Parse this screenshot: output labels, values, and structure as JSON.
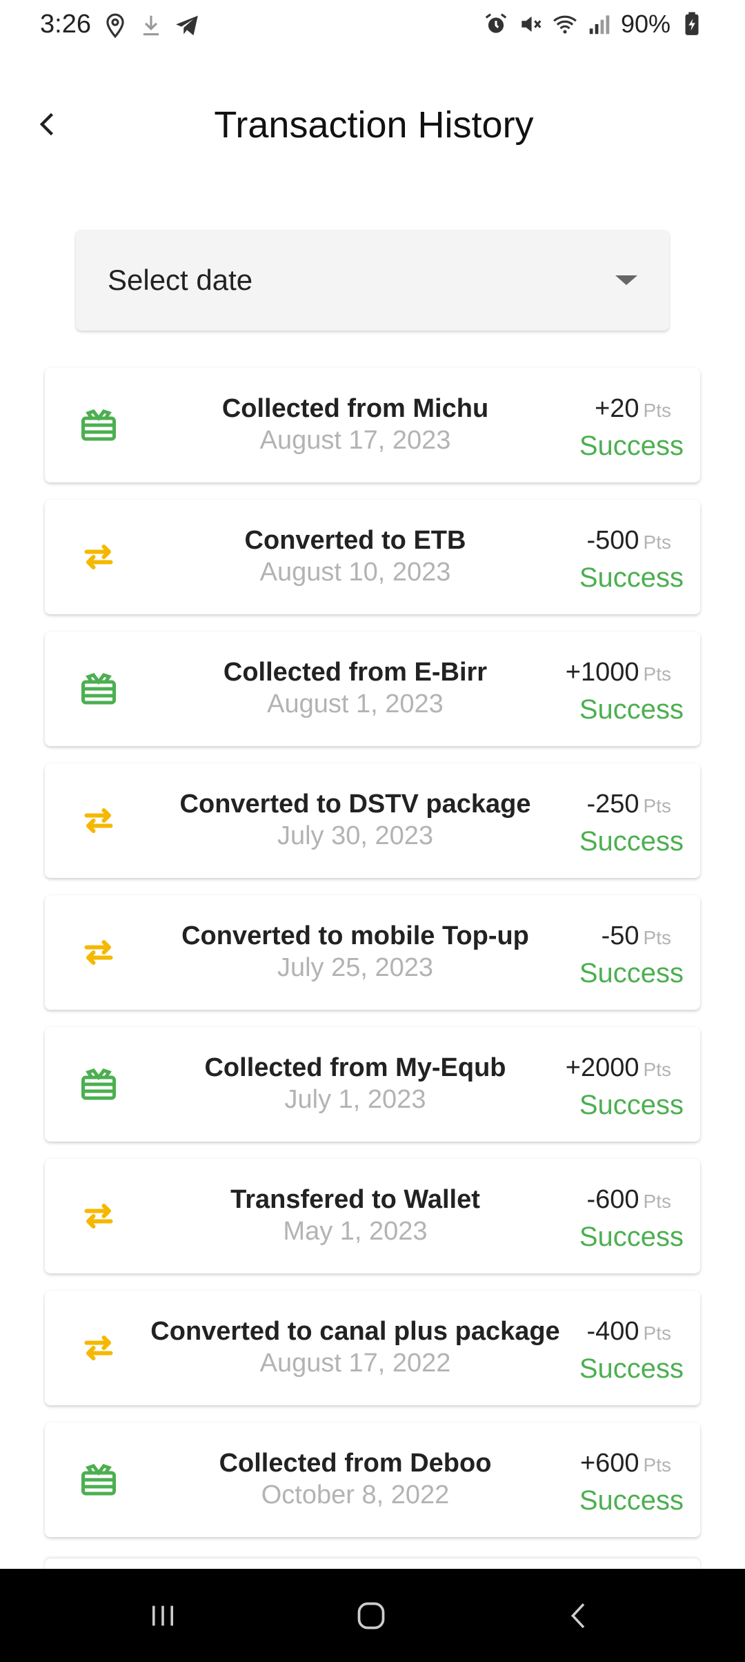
{
  "status_bar": {
    "time": "3:26",
    "battery": "90%",
    "left_icons": [
      "location-icon",
      "download-icon",
      "telegram-icon"
    ],
    "right_icons": [
      "alarm-icon",
      "mute-icon",
      "wifi-icon",
      "signal-icon",
      "battery-icon"
    ]
  },
  "header": {
    "title": "Transaction History",
    "back_icon": "chevron-left-icon"
  },
  "date_filter": {
    "label": "Select date"
  },
  "colors": {
    "success": "#4caf50",
    "collected_icon": "#4caf50",
    "converted_icon": "#f5b800"
  },
  "transactions": [
    {
      "type": "collected",
      "icon": "gift-icon",
      "title": "Collected from Michu",
      "date": "August 17, 2023",
      "amount": "+20",
      "unit": "Pts",
      "status": "Success"
    },
    {
      "type": "converted",
      "icon": "transfer-icon",
      "title": "Converted to ETB",
      "date": "August 10, 2023",
      "amount": "-500",
      "unit": "Pts",
      "status": "Success"
    },
    {
      "type": "collected",
      "icon": "gift-icon",
      "title": "Collected from E-Birr",
      "date": "August 1, 2023",
      "amount": "+1000",
      "unit": "Pts",
      "status": "Success"
    },
    {
      "type": "converted",
      "icon": "transfer-icon",
      "title": "Converted to DSTV package",
      "date": "July 30, 2023",
      "amount": "-250",
      "unit": "Pts",
      "status": "Success"
    },
    {
      "type": "converted",
      "icon": "transfer-icon",
      "title": "Converted to mobile Top-up",
      "date": "July 25, 2023",
      "amount": "-50",
      "unit": "Pts",
      "status": "Success"
    },
    {
      "type": "collected",
      "icon": "gift-icon",
      "title": "Collected from My-Equb",
      "date": "July 1, 2023",
      "amount": "+2000",
      "unit": "Pts",
      "status": "Success"
    },
    {
      "type": "converted",
      "icon": "transfer-icon",
      "title": "Transfered to Wallet",
      "date": "May 1, 2023",
      "amount": "-600",
      "unit": "Pts",
      "status": "Success"
    },
    {
      "type": "converted",
      "icon": "transfer-icon",
      "title": "Converted to canal plus package",
      "date": "August 17, 2022",
      "amount": "-400",
      "unit": "Pts",
      "status": "Success"
    },
    {
      "type": "collected",
      "icon": "gift-icon",
      "title": "Collected from Deboo",
      "date": "October 8, 2022",
      "amount": "+600",
      "unit": "Pts",
      "status": "Success"
    }
  ],
  "nav_bar": {
    "buttons": [
      "recents-icon",
      "home-icon",
      "back-icon"
    ]
  }
}
